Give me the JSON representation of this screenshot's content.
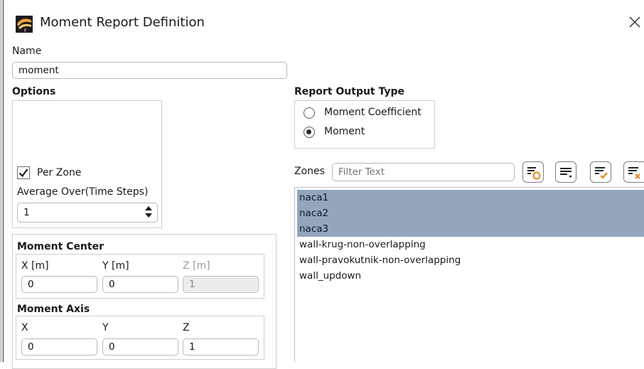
{
  "window": {
    "title": "Moment Report Definition"
  },
  "name_section": {
    "label": "Name",
    "value": "moment"
  },
  "options": {
    "label": "Options",
    "per_zone_label": "Per Zone",
    "per_zone_checked": true,
    "average_over_label": "Average Over(Time Steps)",
    "average_over_value": "1"
  },
  "moment_center": {
    "label": "Moment Center",
    "x_label": "X [m]",
    "y_label": "Y [m]",
    "z_label": "Z [m]",
    "x_value": "0",
    "y_value": "0",
    "z_value": "1"
  },
  "moment_axis": {
    "label": "Moment Axis",
    "x_label": "X",
    "y_label": "Y",
    "z_label": "Z",
    "x_value": "0",
    "y_value": "0",
    "z_value": "1"
  },
  "report_output_type": {
    "label": "Report Output Type",
    "options": [
      "Moment Coefficient",
      "Moment"
    ],
    "selected": "Moment"
  },
  "zones": {
    "label": "Zones",
    "filter_placeholder": "Filter Text",
    "items": [
      {
        "name": "naca1",
        "selected": true
      },
      {
        "name": "naca2",
        "selected": true
      },
      {
        "name": "naca3",
        "selected": true
      },
      {
        "name": "wall-krug-non-overlapping",
        "selected": false
      },
      {
        "name": "wall-pravokutnik-non-overlapping",
        "selected": false
      },
      {
        "name": "wall_updown",
        "selected": false
      }
    ]
  },
  "colors": {
    "selection": "#93a6bb",
    "logo_orange": "#f2a33a"
  }
}
